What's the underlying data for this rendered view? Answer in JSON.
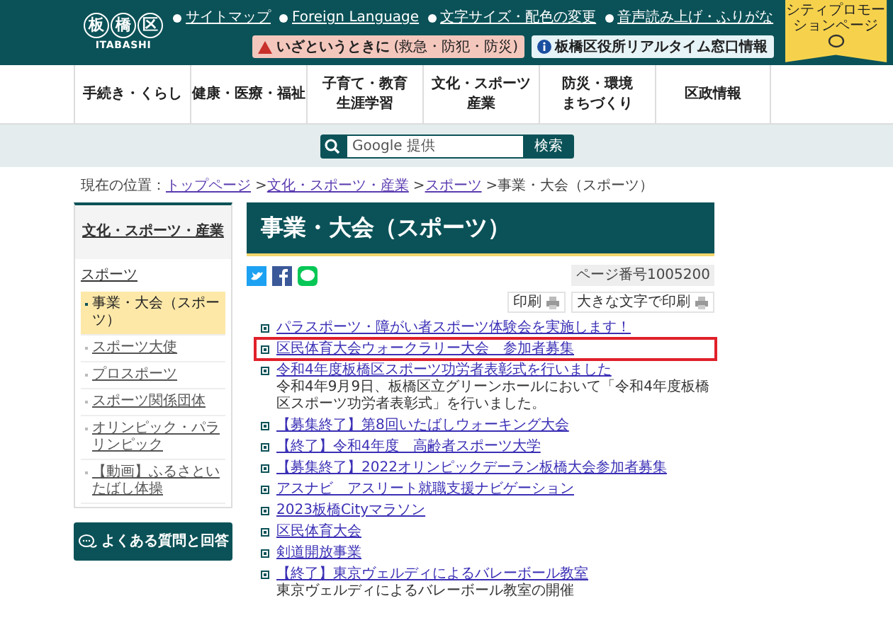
{
  "logo": {
    "chars": [
      "板",
      "橋",
      "区"
    ],
    "romaji": "ITABASHI"
  },
  "top_links": [
    "サイトマップ",
    "Foreign Language",
    "文字サイズ・配色の変更",
    "音声読み上げ・ふりがな"
  ],
  "alert_button": {
    "label": "いざというときに",
    "note": "(救急・防犯・防災)"
  },
  "info_button": {
    "label": "板橋区役所リアルタイム窓口情報"
  },
  "promo": {
    "label": "シティプロモーションページ"
  },
  "nav": [
    {
      "lines": [
        "手続き・くらし"
      ]
    },
    {
      "lines": [
        "健康・医療・福祉"
      ]
    },
    {
      "lines": [
        "子育て・教育",
        "生涯学習"
      ]
    },
    {
      "lines": [
        "文化・スポーツ",
        "産業"
      ]
    },
    {
      "lines": [
        "防災・環境",
        "まちづくり"
      ]
    },
    {
      "lines": [
        "区政情報"
      ]
    }
  ],
  "search": {
    "placeholder": "Google 提供",
    "button": "検索"
  },
  "breadcrumb": {
    "label": "現在の位置：",
    "separator": ">",
    "links": [
      "トップページ",
      "文化・スポーツ・産業",
      "スポーツ"
    ],
    "current": "事業・大会（スポーツ）"
  },
  "sidebar": {
    "heading": "文化・スポーツ・産業",
    "section": "スポーツ",
    "items": [
      {
        "label": "事業・大会（スポーツ）",
        "selected": true
      },
      {
        "label": "スポーツ大使",
        "selected": false
      },
      {
        "label": "プロスポーツ",
        "selected": false
      },
      {
        "label": "スポーツ関係団体",
        "selected": false
      },
      {
        "label": "オリンピック・パラリンピック",
        "selected": false
      },
      {
        "label": "【動画】ふるさといたばし体操",
        "selected": false
      }
    ],
    "faq_button": "よくある質問と回答"
  },
  "page": {
    "title": "事業・大会（スポーツ）",
    "page_number": "ページ番号1005200",
    "print_buttons": [
      "印刷",
      "大きな文字で印刷"
    ]
  },
  "articles": [
    {
      "title": "パラスポーツ・障がい者スポーツ体験会を実施します！",
      "highlighted": false
    },
    {
      "title": "区民体育大会ウォークラリー大会　参加者募集",
      "highlighted": true
    },
    {
      "title": "令和4年度板橋区スポーツ功労者表彰式を行いました",
      "description": "令和4年9月9日、板橋区立グリーンホールにおいて「令和4年度板橋区スポーツ功労者表彰式」を行いました。",
      "highlighted": false
    },
    {
      "title": "【募集終了】第8回いたばしウォーキング大会",
      "highlighted": false
    },
    {
      "title": "【終了】令和4年度　高齢者スポーツ大学",
      "highlighted": false
    },
    {
      "title": "【募集終了】2022オリンピックデーラン板橋大会参加者募集",
      "highlighted": false
    },
    {
      "title": "アスナビ　アスリート就職支援ナビゲーション",
      "highlighted": false
    },
    {
      "title": "2023板橋Cityマラソン",
      "highlighted": false
    },
    {
      "title": "区民体育大会",
      "highlighted": false
    },
    {
      "title": "剣道開放事業",
      "highlighted": false
    },
    {
      "title": "【終了】東京ヴェルディによるバレーボール教室",
      "description": "東京ヴェルディによるバレーボール教室の開催",
      "highlighted": false
    }
  ]
}
